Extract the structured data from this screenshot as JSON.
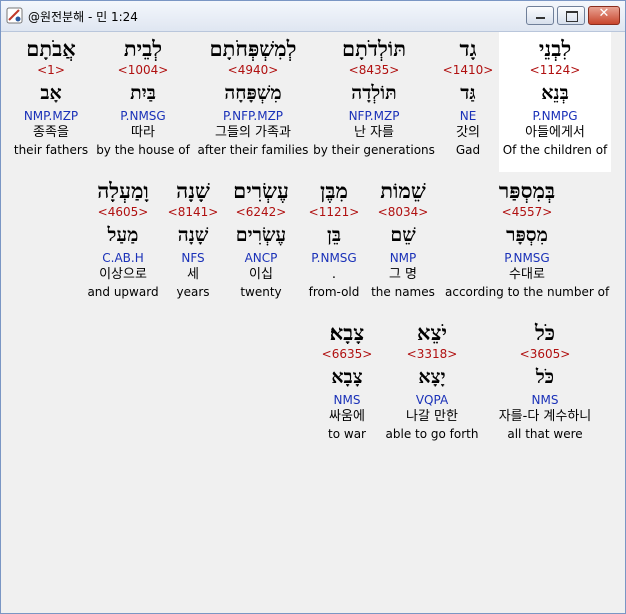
{
  "window": {
    "title": "@원전분해 - 민 1:24",
    "buttons": {
      "minimize": "",
      "maximize": "",
      "close": "✕"
    }
  },
  "colors": {
    "number": "#b01010",
    "grammar": "#1a31b8",
    "selected_bg": "#ffffff"
  },
  "rows": [
    [
      {
        "heb": "לִבְנֵי",
        "num": "<1124>",
        "lemma": "בְּנֵא",
        "gram": "P.NMPG",
        "kor": "아들에게서",
        "eng": "Of the children of"
      },
      {
        "heb": "גָד",
        "num": "<1410>",
        "lemma": "גַּד",
        "gram": "NE",
        "kor": "갓의",
        "eng": "Gad"
      },
      {
        "heb": "תּוֹלְדֹתָם",
        "num": "<8435>",
        "lemma": "תּוֹלְדָה",
        "gram": "NFP.MZP",
        "kor": "난 자를",
        "eng": "by their generations"
      },
      {
        "heb": "לְמִשְׁפְּחֹתָם",
        "num": "<4940>",
        "lemma": "מִשְׁפָּחָה",
        "gram": "P.NFP.MZP",
        "kor": "그들의 가족과",
        "eng": "after their families"
      },
      {
        "heb": "לְבֵית",
        "num": "<1004>",
        "lemma": "בַּיִת",
        "gram": "P.NMSG",
        "kor": "따라",
        "eng": "by the house of"
      },
      {
        "heb": "אֲבֹתָם",
        "num": "<1>",
        "lemma": "אָב",
        "gram": "NMP.MZP",
        "kor": "종족을",
        "eng": "their fathers"
      }
    ],
    [
      {
        "heb": "בְּמִסְפַּר",
        "num": "<4557>",
        "lemma": "מִסְפָּר",
        "gram": "P.NMSG",
        "kor": "수대로",
        "eng": "according to the number of"
      },
      {
        "heb": "שֵׁמוֹת",
        "num": "<8034>",
        "lemma": "שֵׁם",
        "gram": "NMP",
        "kor": "그 명",
        "eng": "the names"
      },
      {
        "heb": "מִבֶּן",
        "num": "<1121>",
        "lemma": "בֵּן",
        "gram": "P.NMSG",
        "kor": ".",
        "eng": "from-old"
      },
      {
        "heb": "עֶשְׂרִים",
        "num": "<6242>",
        "lemma": "עֶשְׂרִים",
        "gram": "ANCP",
        "kor": "이십",
        "eng": "twenty"
      },
      {
        "heb": "שָׁנָה",
        "num": "<8141>",
        "lemma": "שָׁנָה",
        "gram": "NFS",
        "kor": "세",
        "eng": "years"
      },
      {
        "heb": "וָמַעְלָה",
        "num": "<4605>",
        "lemma": "מַעַל",
        "gram": "C.AB.H",
        "kor": "이상으로",
        "eng": "and upward"
      }
    ],
    [
      {
        "heb": "כֹּל",
        "num": "<3605>",
        "lemma": "כֹּל",
        "gram": "NMS",
        "kor": "자를-다 계수하니",
        "eng": "all that were"
      },
      {
        "heb": "יֹצֵא",
        "num": "<3318>",
        "lemma": "יָצָא",
        "gram": "VQPA",
        "kor": "나갈 만한",
        "eng": "able to go forth"
      },
      {
        "heb": "צָבָא׃",
        "num": "<6635>",
        "lemma": "צָבָא",
        "gram": "NMS",
        "kor": "싸움에",
        "eng": "to war"
      }
    ]
  ]
}
